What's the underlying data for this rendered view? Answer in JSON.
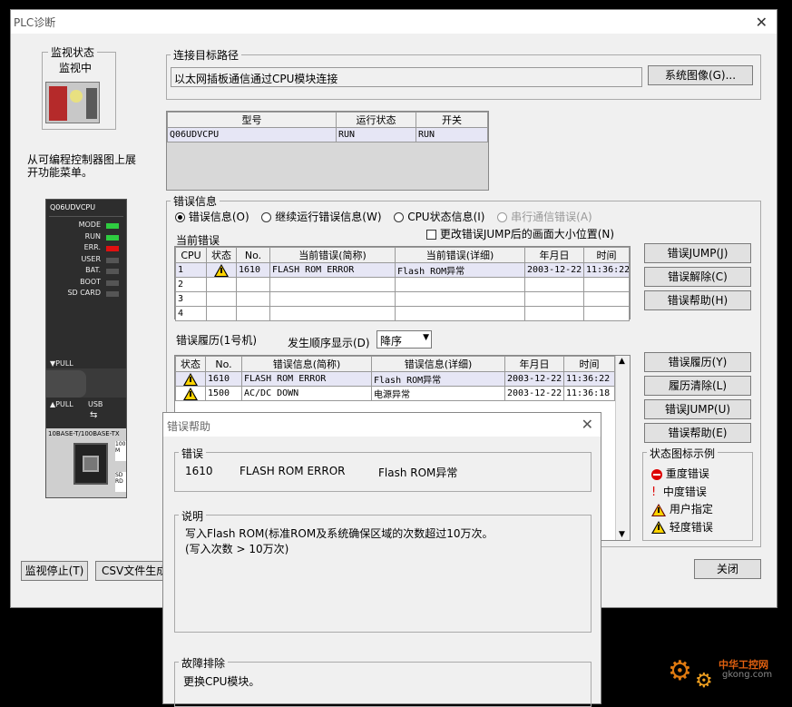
{
  "window": {
    "title": "PLC诊断"
  },
  "monitor": {
    "group_label": "监视状态",
    "status": "监视中"
  },
  "left_hint": "从可编程控制器图上展开功能菜单。",
  "plc": {
    "model_label": "Q06UDVCPU",
    "leds": [
      "MODE",
      "RUN",
      "ERR.",
      "USER",
      "BAT.",
      "BOOT",
      "SD CARD"
    ],
    "pull1": "▼PULL",
    "pull2": "▲PULL",
    "usb": "USB",
    "eth": "10BASE-T/100BASE-TX",
    "side1": "100 M",
    "side2": "SD RD"
  },
  "connection": {
    "group_label": "连接目标路径",
    "path": "以太网插板通信通过CPU模块连接",
    "system_image_button": "系统图像(G)..."
  },
  "model_table": {
    "headers": [
      "型号",
      "运行状态",
      "开关"
    ],
    "rows": [
      [
        "Q06UDVCPU",
        "RUN",
        "RUN"
      ]
    ]
  },
  "error_info": {
    "group_label": "错误信息",
    "radios": [
      "错误信息(O)",
      "继续运行错误信息(W)",
      "CPU状态信息(I)",
      "串行通信错误(A)"
    ],
    "checkbox": "更改错误JUMP后的画面大小位置(N)",
    "current_label": "当前错误"
  },
  "current_table": {
    "headers": [
      "CPU",
      "状态",
      "No.",
      "当前错误(简称)",
      "当前错误(详细)",
      "年月日",
      "时间"
    ],
    "rows": [
      [
        "1",
        "warn",
        "1610",
        "FLASH ROM ERROR",
        "Flash ROM异常",
        "2003-12-22",
        "11:36:22"
      ],
      [
        "2",
        "",
        "",
        "",
        "",
        "",
        ""
      ],
      [
        "3",
        "",
        "",
        "",
        "",
        "",
        ""
      ],
      [
        "4",
        "",
        "",
        "",
        "",
        "",
        ""
      ]
    ]
  },
  "current_buttons": [
    "错误JUMP(J)",
    "错误解除(C)",
    "错误帮助(H)"
  ],
  "history": {
    "label": "错误履历(1号机)",
    "order_label": "发生顺序显示(D)",
    "order_value": "降序"
  },
  "history_table": {
    "headers": [
      "状态",
      "No.",
      "错误信息(简称)",
      "错误信息(详细)",
      "年月日",
      "时间"
    ],
    "rows": [
      [
        "warn",
        "1610",
        "FLASH ROM ERROR",
        "Flash ROM异常",
        "2003-12-22",
        "11:36:22"
      ],
      [
        "warn",
        "1500",
        "AC/DC DOWN",
        "电源异常",
        "2003-12-22",
        "11:36:18"
      ]
    ]
  },
  "history_buttons": [
    "错误履历(Y)",
    "履历清除(L)",
    "错误JUMP(U)",
    "错误帮助(E)"
  ],
  "legend": {
    "label": "状态图标示例",
    "items": [
      "重度错误",
      "中度错误",
      "用户指定",
      "轻度错误"
    ]
  },
  "bottom": {
    "stop_button": "监视停止(T)",
    "csv_button": "CSV文件生成",
    "close_button": "关闭"
  },
  "help_dialog": {
    "title": "错误帮助",
    "error_label": "错误",
    "error_no": "1610",
    "error_short": "FLASH ROM ERROR",
    "error_detail": "Flash ROM异常",
    "desc_label": "说明",
    "desc_line1": "写入Flash ROM(标准ROM及系统确保区域的次数超过10万次。",
    "desc_line2": "(写入次数 > 10万次)",
    "trouble_label": "故障排除",
    "trouble_text": "更换CPU模块。"
  },
  "watermark": {
    "site": "中华工控网",
    "url": "gkong.com"
  }
}
